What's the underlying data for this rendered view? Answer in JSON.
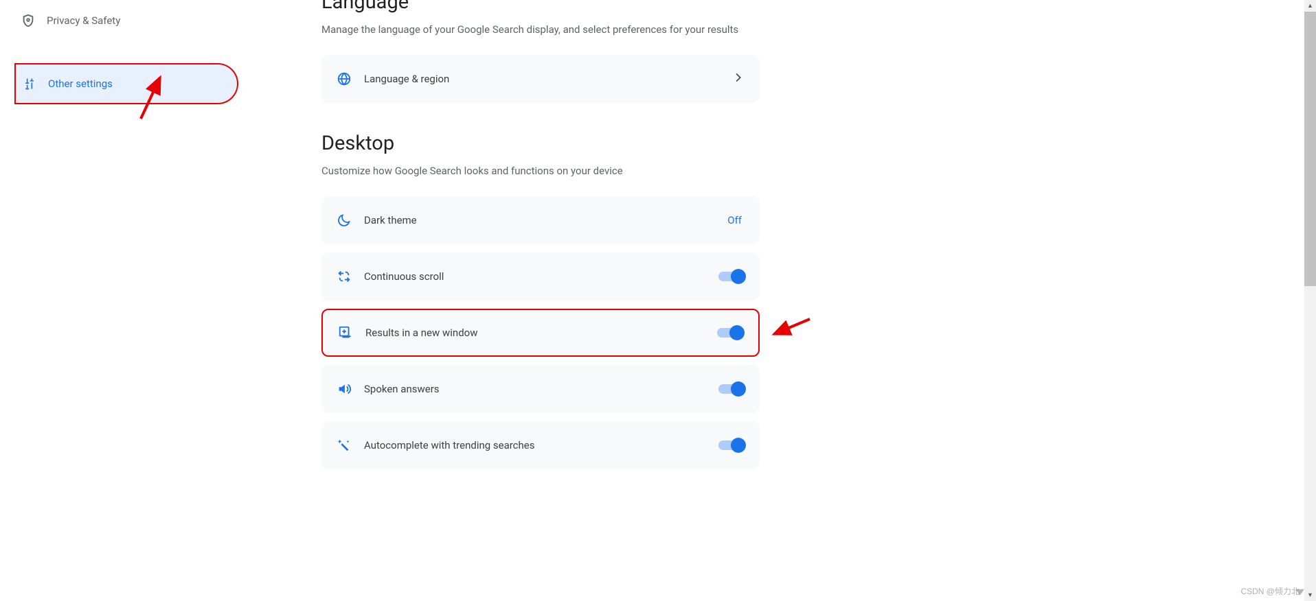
{
  "sidebar": {
    "privacy": {
      "label": "Privacy & Safety"
    },
    "other": {
      "label": "Other settings"
    }
  },
  "language_section": {
    "title": "Language",
    "desc": "Manage the language of your Google Search display, and select preferences for your results",
    "card_label": "Language & region"
  },
  "desktop_section": {
    "title": "Desktop",
    "desc": "Customize how Google Search looks and functions on your device",
    "dark_theme": {
      "label": "Dark theme",
      "value": "Off"
    },
    "continuous_scroll": {
      "label": "Continuous scroll"
    },
    "new_window": {
      "label": "Results in a new window"
    },
    "spoken": {
      "label": "Spoken answers"
    },
    "autocomplete": {
      "label": "Autocomplete with trending searches"
    }
  },
  "watermark": "CSDN @倾力北"
}
